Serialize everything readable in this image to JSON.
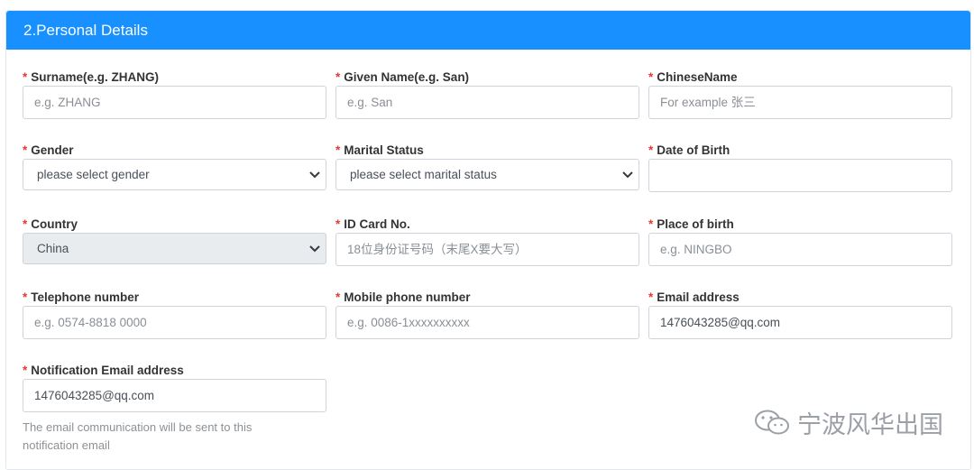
{
  "section": {
    "title": "2.Personal Details"
  },
  "fields": {
    "surname": {
      "label": "Surname(e.g. ZHANG)",
      "placeholder": "e.g. ZHANG",
      "value": ""
    },
    "given": {
      "label": "Given Name(e.g. San)",
      "placeholder": "e.g. San",
      "value": ""
    },
    "chinese": {
      "label": "ChineseName",
      "placeholder": "For example 张三",
      "value": ""
    },
    "gender": {
      "label": "Gender",
      "selected": "please select gender"
    },
    "marital": {
      "label": "Marital Status",
      "selected": "please select marital status"
    },
    "dob": {
      "label": "Date of Birth",
      "placeholder": "",
      "value": ""
    },
    "country": {
      "label": "Country",
      "selected": "China"
    },
    "idcard": {
      "label": "ID Card No.",
      "placeholder": "18位身份证号码（末尾X要大写）",
      "value": ""
    },
    "pob": {
      "label": "Place of birth",
      "placeholder": "e.g. NINGBO",
      "value": ""
    },
    "telephone": {
      "label": "Telephone number",
      "placeholder": "e.g. 0574-8818 0000",
      "value": ""
    },
    "mobile": {
      "label": "Mobile phone number",
      "placeholder": "e.g. 0086-1xxxxxxxxxx",
      "value": ""
    },
    "email": {
      "label": "Email address",
      "placeholder": "",
      "value": "1476043285@qq.com"
    },
    "notify": {
      "label": "Notification Email address",
      "placeholder": "",
      "value": "1476043285@qq.com",
      "help": "The email communication will be sent to this notification email"
    }
  },
  "required_marker": "*",
  "watermark": {
    "text": "宁波风华出国",
    "icon": "wechat-icon"
  },
  "colors": {
    "header": "#1890ff",
    "required": "#e53935"
  }
}
